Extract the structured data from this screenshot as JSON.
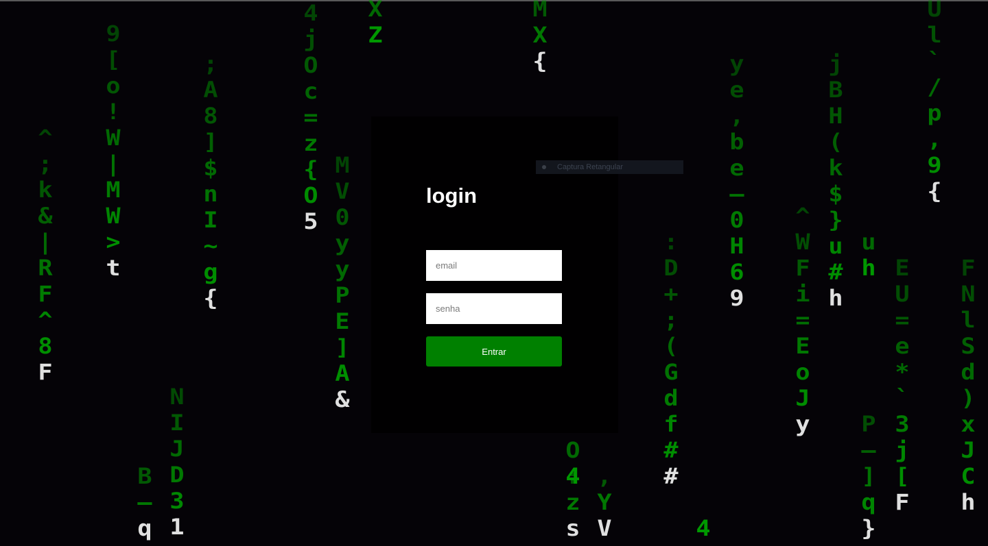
{
  "background": {
    "color": "#050307",
    "rain_glyph_color": "#00a000",
    "rain_head_color": "#e0e0e0",
    "columns": [
      {
        "chars": [
          "^",
          ";",
          "k",
          "&",
          "|",
          "R",
          "F",
          "^",
          "8",
          "F"
        ]
      },
      {
        "chars": [
          "9",
          "[",
          "o",
          "!",
          "W",
          "|",
          "M",
          "W",
          ">",
          "t"
        ]
      },
      {
        "chars": [
          "N",
          "I",
          "J",
          "D",
          "3",
          "1"
        ]
      },
      {
        "chars": [
          "B",
          "—",
          "q"
        ]
      },
      {
        "chars": [
          ";",
          "A",
          "8",
          "]",
          "$",
          "n",
          "I",
          "~",
          "g",
          "{"
        ]
      },
      {
        "chars": [
          "4",
          "j",
          "O",
          "c",
          "=",
          "z",
          "{",
          "O",
          "5"
        ]
      },
      {
        "chars": [
          "M",
          "V",
          "0",
          "y",
          "y",
          "P",
          "E",
          "]",
          "A",
          "&"
        ]
      },
      {
        "chars": [
          "X",
          "Z"
        ]
      },
      {
        "chars": [
          "M",
          "X",
          "{"
        ]
      },
      {
        "chars": [
          "O",
          "4"
        ]
      },
      {
        "chars": [
          ":",
          "z",
          "s"
        ]
      },
      {
        "chars": [
          ",",
          "Y",
          "V"
        ]
      },
      {
        "chars": [
          ":",
          "D",
          "+",
          ";",
          "(",
          "G",
          "d",
          "f",
          "#",
          "#"
        ]
      },
      {
        "chars": [
          "y",
          "e",
          ",",
          "b",
          "e",
          "—",
          "0",
          "H",
          "6",
          "9"
        ]
      },
      {
        "chars": [
          "4"
        ]
      },
      {
        "chars": [
          "^",
          "W",
          "F",
          "i",
          "=",
          "E",
          "o",
          "J",
          "y"
        ]
      },
      {
        "chars": [
          "j",
          "B",
          "H",
          "(",
          "k",
          "$",
          "}",
          "u",
          "#",
          "h"
        ]
      },
      {
        "chars": [
          "u",
          "h"
        ]
      },
      {
        "chars": [
          "P",
          "—",
          "]",
          "q",
          "}"
        ]
      },
      {
        "chars": [
          "E",
          "U",
          "=",
          "e",
          "*",
          "`",
          "3",
          "j",
          "[",
          "F"
        ]
      },
      {
        "chars": [
          "U",
          "l",
          "`",
          "/",
          "p",
          ",",
          "9",
          "{"
        ]
      },
      {
        "chars": [
          "F",
          "N",
          "l",
          "S",
          "d",
          ")",
          "x",
          "J",
          "C",
          "h"
        ]
      }
    ]
  },
  "login": {
    "title": "login",
    "email_placeholder": "email",
    "password_placeholder": "senha",
    "submit_label": "Entrar",
    "button_color": "#008000"
  },
  "overlay_tooltip": {
    "text": "Captura Retangular"
  }
}
